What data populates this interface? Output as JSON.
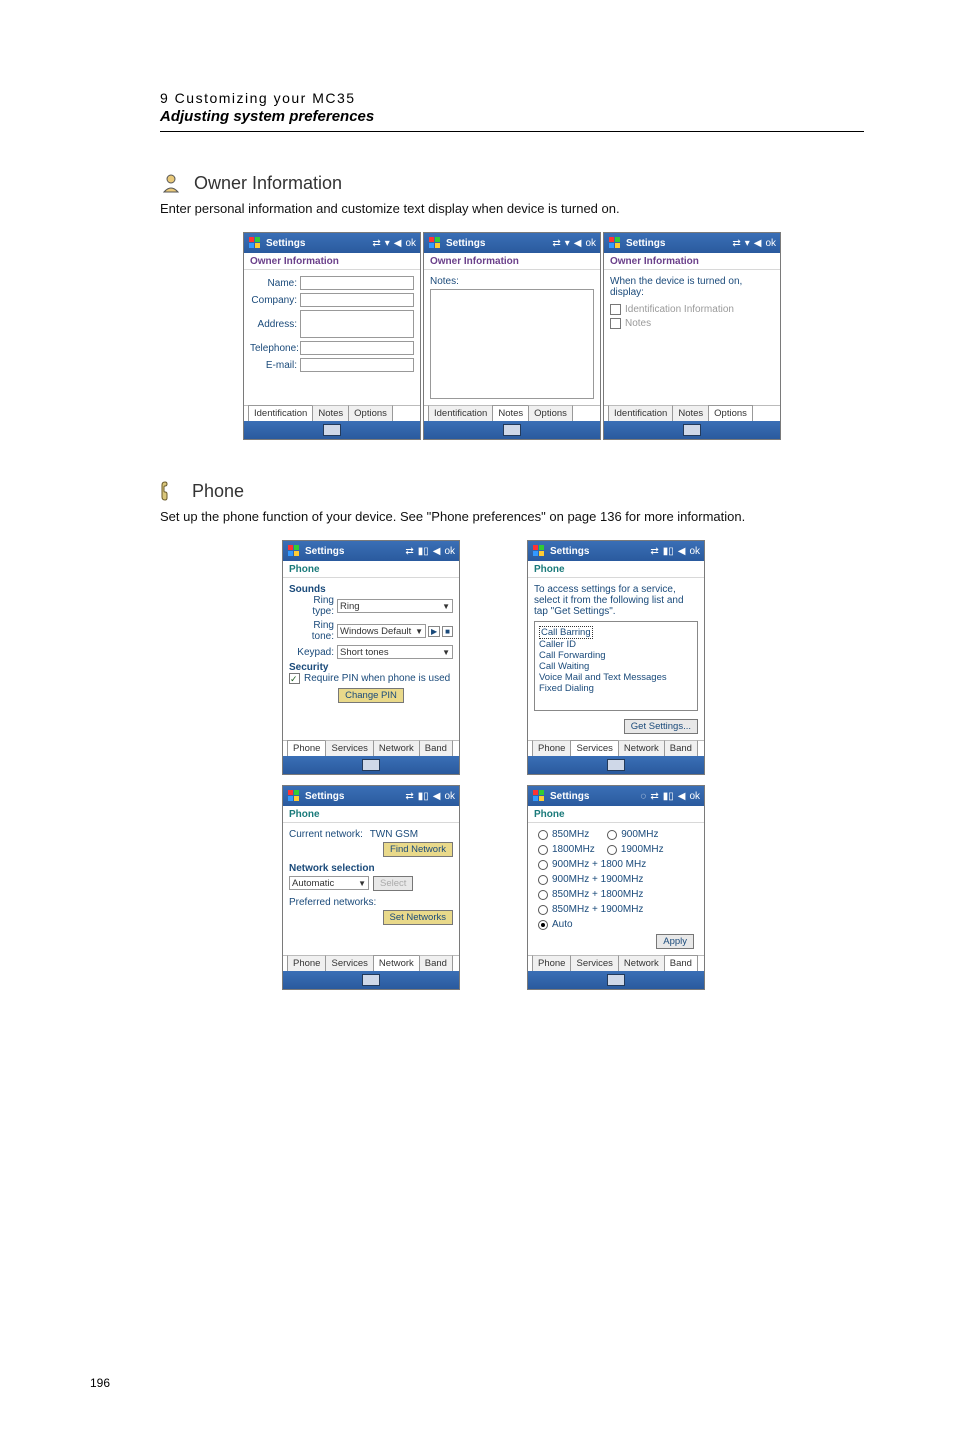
{
  "header": {
    "line1": "9 Customizing your MC35",
    "line2": "Adjusting system preferences"
  },
  "owner_section": {
    "title": "Owner Information",
    "text": "Enter personal information and customize text display when device is turned on."
  },
  "owner_shots": {
    "titlebar": {
      "app": "Settings",
      "ok": "ok"
    },
    "subheader": "Owner Information",
    "ident": {
      "fields": {
        "name": "Name:",
        "company": "Company:",
        "address": "Address:",
        "telephone": "Telephone:",
        "email": "E-mail:"
      }
    },
    "notes": {
      "label": "Notes:"
    },
    "options": {
      "line1": "When the device is turned on, display:",
      "chk1": "Identification Information",
      "chk2": "Notes"
    },
    "tabs": [
      "Identification",
      "Notes",
      "Options"
    ]
  },
  "phone_section": {
    "title": "Phone",
    "text": "Set up the phone function of your device. See \"Phone preferences\" on page 136 for more information."
  },
  "phone_shots": {
    "titlebar": {
      "app": "Settings",
      "ok": "ok"
    },
    "subheader": "Phone",
    "tabs": [
      "Phone",
      "Services",
      "Network",
      "Band"
    ],
    "sounds": {
      "heading": "Sounds",
      "ringtype_label": "Ring type:",
      "ringtype_value": "Ring",
      "ringtone_label": "Ring tone:",
      "ringtone_value": "Windows Default",
      "keypad_label": "Keypad:",
      "keypad_value": "Short tones",
      "security_heading": "Security",
      "require_pin": "Require PIN when phone is used",
      "change_pin": "Change PIN"
    },
    "services": {
      "desc": "To access settings for a service, select it from the following list and tap \"Get Settings\".",
      "list": [
        "Call Barring",
        "Caller ID",
        "Call Forwarding",
        "Call Waiting",
        "Voice Mail and Text Messages",
        "Fixed Dialing"
      ],
      "button": "Get Settings..."
    },
    "network": {
      "current_label": "Current network:",
      "current_value": "TWN GSM",
      "find_btn": "Find Network",
      "selection_heading": "Network selection",
      "mode": "Automatic",
      "select_btn": "Select",
      "preferred_label": "Preferred networks:",
      "set_btn": "Set Networks"
    },
    "band": {
      "opts": [
        "850MHz",
        "900MHz",
        "1800MHz",
        "1900MHz",
        "900MHz + 1800 MHz",
        "900MHz + 1900MHz",
        "850MHz + 1800MHz",
        "850MHz + 1900MHz",
        "Auto"
      ],
      "selected": "Auto",
      "apply": "Apply"
    }
  },
  "page_number": "196"
}
